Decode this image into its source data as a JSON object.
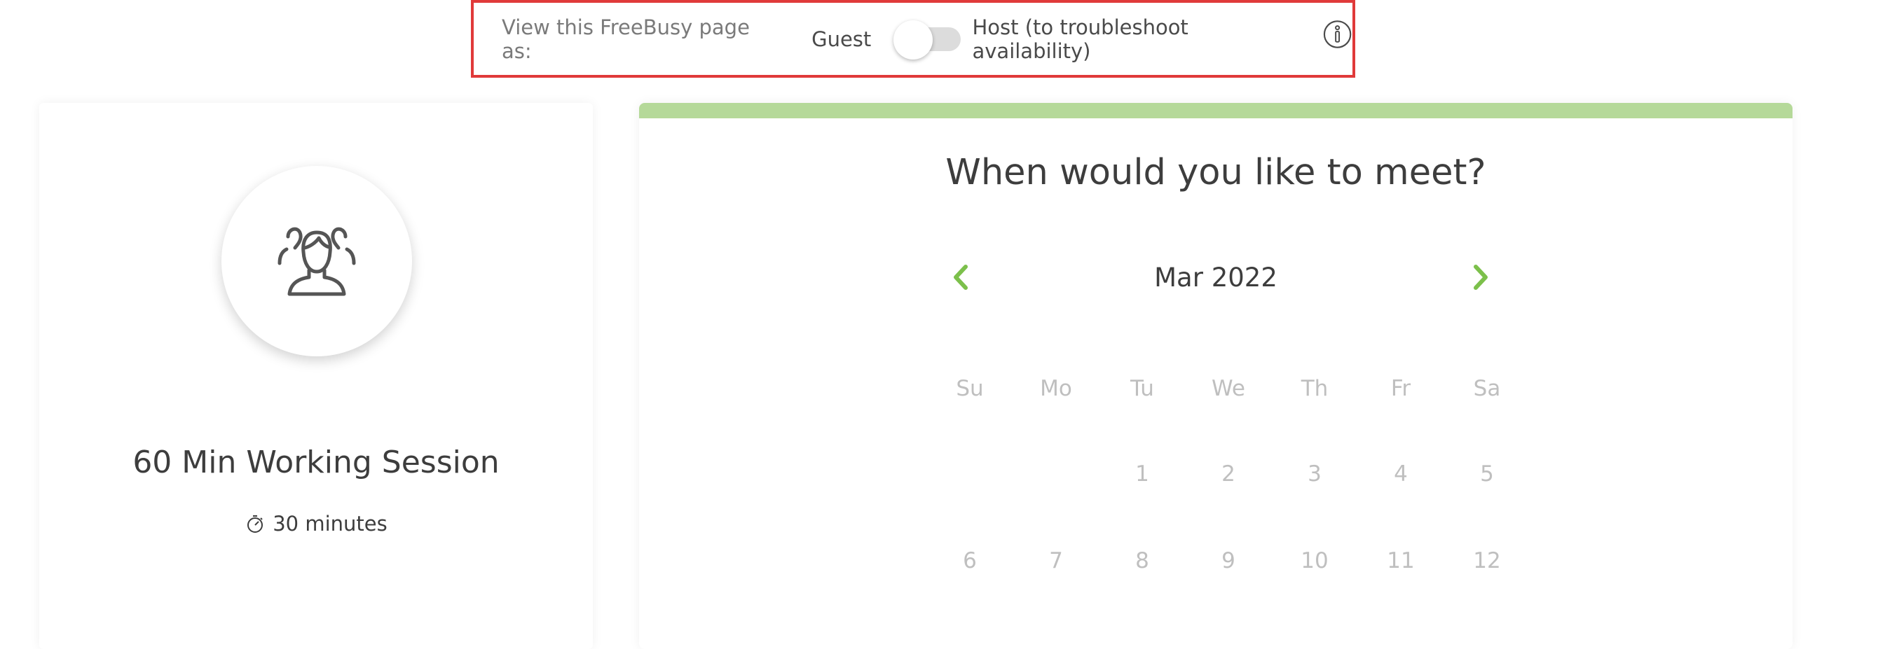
{
  "view_as": {
    "label": "View this FreeBusy page as:",
    "guest_label": "Guest",
    "host_label": "Host (to troubleshoot availability)",
    "toggle_state": "guest",
    "info_icon": "info-icon"
  },
  "event": {
    "title": "60 Min Working Session",
    "duration": "30 minutes",
    "avatar_icon": "group-users-icon",
    "duration_icon": "stopwatch-icon"
  },
  "calendar": {
    "heading": "When would you like to meet?",
    "month": "Mar 2022",
    "prev_icon": "chevron-left-icon",
    "next_icon": "chevron-right-icon",
    "weekdays": [
      "Su",
      "Mo",
      "Tu",
      "We",
      "Th",
      "Fr",
      "Sa"
    ],
    "weeks": [
      [
        "",
        "",
        "1",
        "2",
        "3",
        "4",
        "5"
      ],
      [
        "6",
        "7",
        "8",
        "9",
        "10",
        "11",
        "12"
      ]
    ]
  },
  "colors": {
    "accent_green": "#8dc63f",
    "top_bar_green": "#b5d999",
    "highlight_red": "#e03a3a"
  }
}
